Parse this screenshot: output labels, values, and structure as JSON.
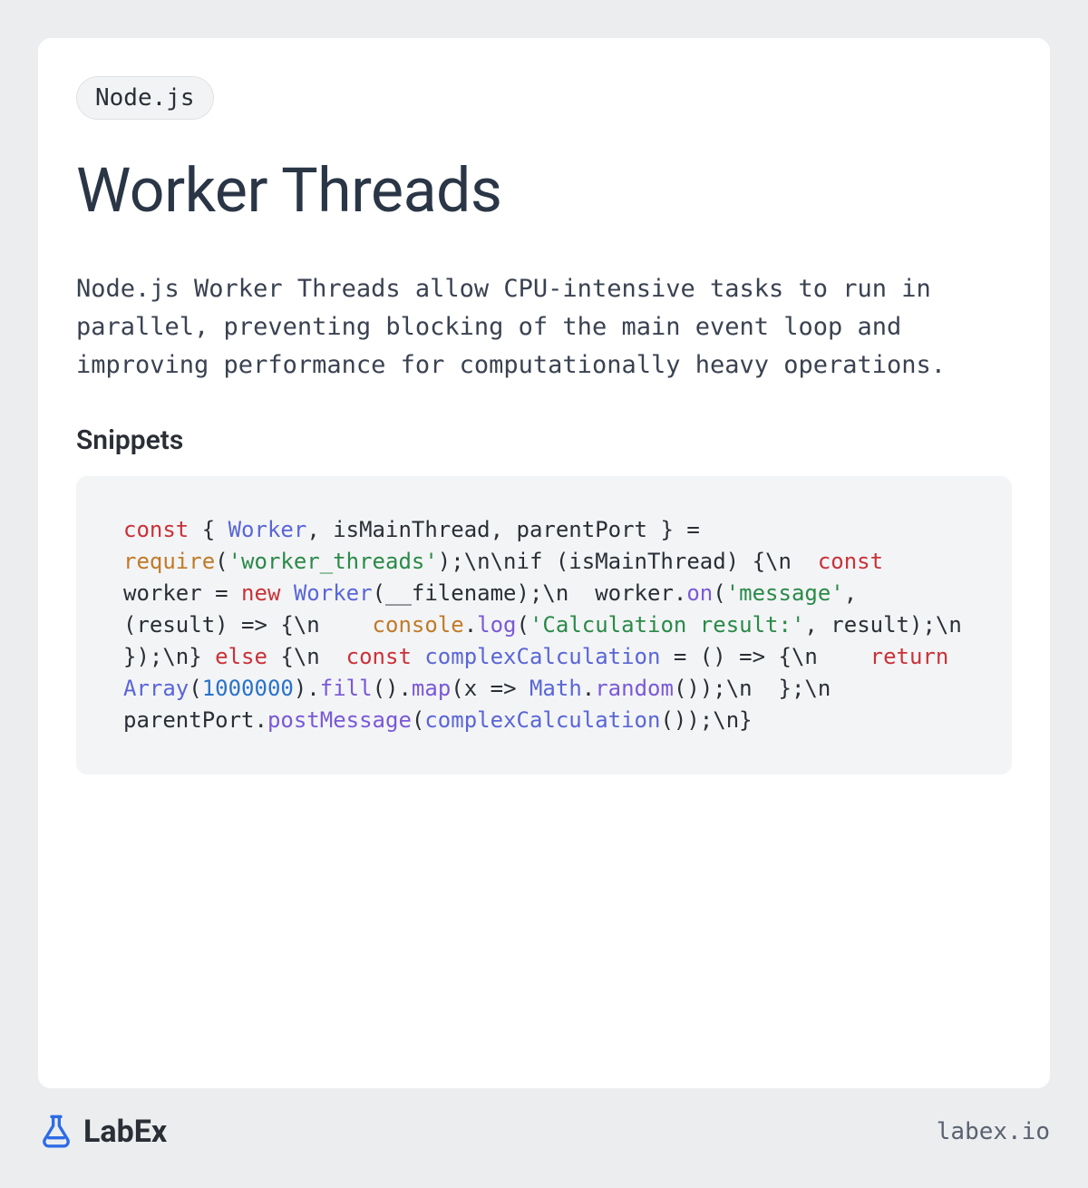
{
  "tag": "Node.js",
  "title": "Worker Threads",
  "description": "Node.js Worker Threads allow CPU-intensive tasks to run in parallel, preventing blocking of the main event loop and improving performance for computationally heavy operations.",
  "snippets_heading": "Snippets",
  "code_tokens": [
    {
      "t": "const",
      "c": "kw"
    },
    {
      "t": " { "
    },
    {
      "t": "Worker",
      "c": "cls"
    },
    {
      "t": ", isMainThread, parentPort } = "
    },
    {
      "t": "require",
      "c": "fn"
    },
    {
      "t": "("
    },
    {
      "t": "'worker_threads'",
      "c": "str"
    },
    {
      "t": ");\\n\\nif (isMainThread) {\\n  "
    },
    {
      "t": "const",
      "c": "kw"
    },
    {
      "t": " worker = "
    },
    {
      "t": "new",
      "c": "kw"
    },
    {
      "t": " "
    },
    {
      "t": "Worker",
      "c": "cls"
    },
    {
      "t": "(__filename);\\n  worker."
    },
    {
      "t": "on",
      "c": "prp"
    },
    {
      "t": "("
    },
    {
      "t": "'message'",
      "c": "str"
    },
    {
      "t": ", (result) => {\\n    "
    },
    {
      "t": "console",
      "c": "fn"
    },
    {
      "t": "."
    },
    {
      "t": "log",
      "c": "prp"
    },
    {
      "t": "("
    },
    {
      "t": "'Calculation result:'",
      "c": "str"
    },
    {
      "t": ", result);\\n  });\\n} "
    },
    {
      "t": "else",
      "c": "kw"
    },
    {
      "t": " {\\n  "
    },
    {
      "t": "const",
      "c": "kw"
    },
    {
      "t": " "
    },
    {
      "t": "complexCalculation",
      "c": "cls"
    },
    {
      "t": " = () => {\\n    "
    },
    {
      "t": "return",
      "c": "kw"
    },
    {
      "t": " "
    },
    {
      "t": "Array",
      "c": "cls"
    },
    {
      "t": "("
    },
    {
      "t": "1000000",
      "c": "num"
    },
    {
      "t": ")."
    },
    {
      "t": "fill",
      "c": "prp"
    },
    {
      "t": "()."
    },
    {
      "t": "map",
      "c": "prp"
    },
    {
      "t": "(x => "
    },
    {
      "t": "Math",
      "c": "cls"
    },
    {
      "t": "."
    },
    {
      "t": "random",
      "c": "prp"
    },
    {
      "t": "());\\n  };\\n  parentPort."
    },
    {
      "t": "postMessage",
      "c": "prp"
    },
    {
      "t": "("
    },
    {
      "t": "complexCalculation",
      "c": "cls"
    },
    {
      "t": "());\\n}"
    }
  ],
  "brand": "LabEx",
  "site": "labex.io"
}
